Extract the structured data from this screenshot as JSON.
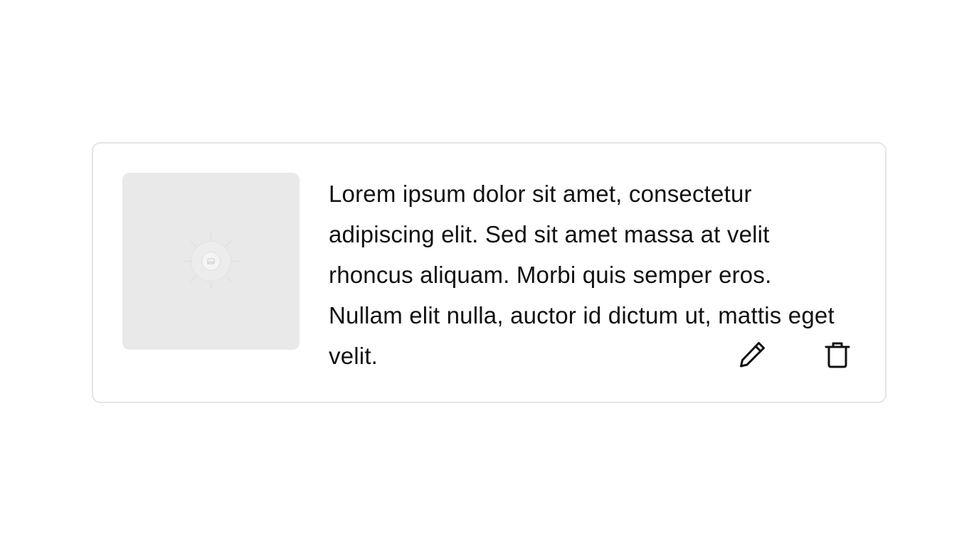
{
  "card": {
    "description": "Lorem ipsum dolor sit amet, consectetur adipiscing elit. Sed sit amet massa at velit rhoncus aliquam. Morbi quis semper eros. Nullam elit nulla, auctor id dictum ut, mattis eget velit.",
    "thumbnail_icon": "image-placeholder-icon",
    "actions": {
      "edit_icon": "pencil-icon",
      "delete_icon": "trash-icon"
    }
  },
  "colors": {
    "card_border": "#e5e5e5",
    "thumbnail_bg": "#e9e9e9",
    "text": "#111111",
    "icon_stroke": "#111111"
  }
}
